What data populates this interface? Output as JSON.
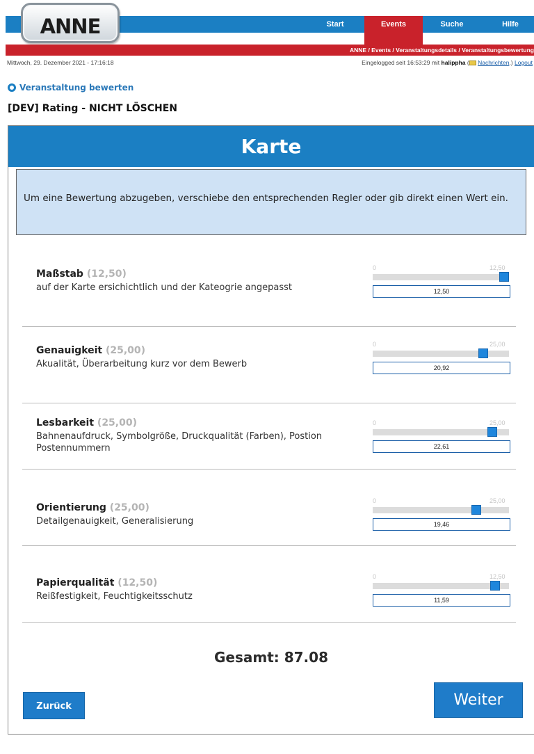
{
  "header": {
    "logo_text": "ANNE",
    "nav": [
      {
        "label": "Start",
        "active": false
      },
      {
        "label": "Events",
        "active": true
      },
      {
        "label": "Suche",
        "active": false
      },
      {
        "label": "Hilfe",
        "active": false
      }
    ],
    "breadcrumb": "ANNE / Events / Veranstaltungsdetails / Veranstaltungsbewertung",
    "datetime": "Mittwoch, 29. Dezember 2021 - 17:16:18",
    "login_prefix": "Eingelogged seit 16:53:29 mit",
    "username": "halippha",
    "messages_link": "Nachrichten",
    "logout_link": "Logout",
    "colors": {
      "blue": "#1b7fc3",
      "red": "#c9222b"
    }
  },
  "page": {
    "section_link": "Veranstaltung bewerten",
    "event_name": "[DEV] Rating - NICHT LÖSCHEN"
  },
  "panel": {
    "title": "Karte",
    "info": "Um eine Bewertung abzugeben, verschiebe den entsprechenden Regler oder gib direkt einen Wert ein."
  },
  "criteria": [
    {
      "title": "Maßstab",
      "max_label": "(12,50)",
      "description": "auf der Karte ersichichtlich und der Kateogrie angepasst",
      "slider_min": "0",
      "slider_max": "12,50",
      "value": "12,50",
      "fraction": 1.0
    },
    {
      "title": "Genauigkeit",
      "max_label": "(25,00)",
      "description": "Akualität, Überarbeitung kurz vor dem Bewerb",
      "slider_min": "0",
      "slider_max": "25,00",
      "value": "20,92",
      "fraction": 0.8368
    },
    {
      "title": "Lesbarkeit",
      "max_label": "(25,00)",
      "description": "Bahnenaufdruck, Symbolgröße, Druckqualität (Farben), Postion Postennummern",
      "slider_min": "0",
      "slider_max": "25,00",
      "value": "22,61",
      "fraction": 0.9044
    },
    {
      "title": "Orientierung",
      "max_label": "(25,00)",
      "description": "Detailgenauigkeit, Generalisierung",
      "slider_min": "0",
      "slider_max": "25,00",
      "value": "19,46",
      "fraction": 0.7784
    },
    {
      "title": "Papierqualität",
      "max_label": "(12,50)",
      "description": "Reißfestigkeit, Feuchtigkeitsschutz",
      "slider_min": "0",
      "slider_max": "12,50",
      "value": "11,59",
      "fraction": 0.9272
    }
  ],
  "total": "Gesamt: 87.08",
  "buttons": {
    "back": "Zurück",
    "next": "Weiter"
  }
}
